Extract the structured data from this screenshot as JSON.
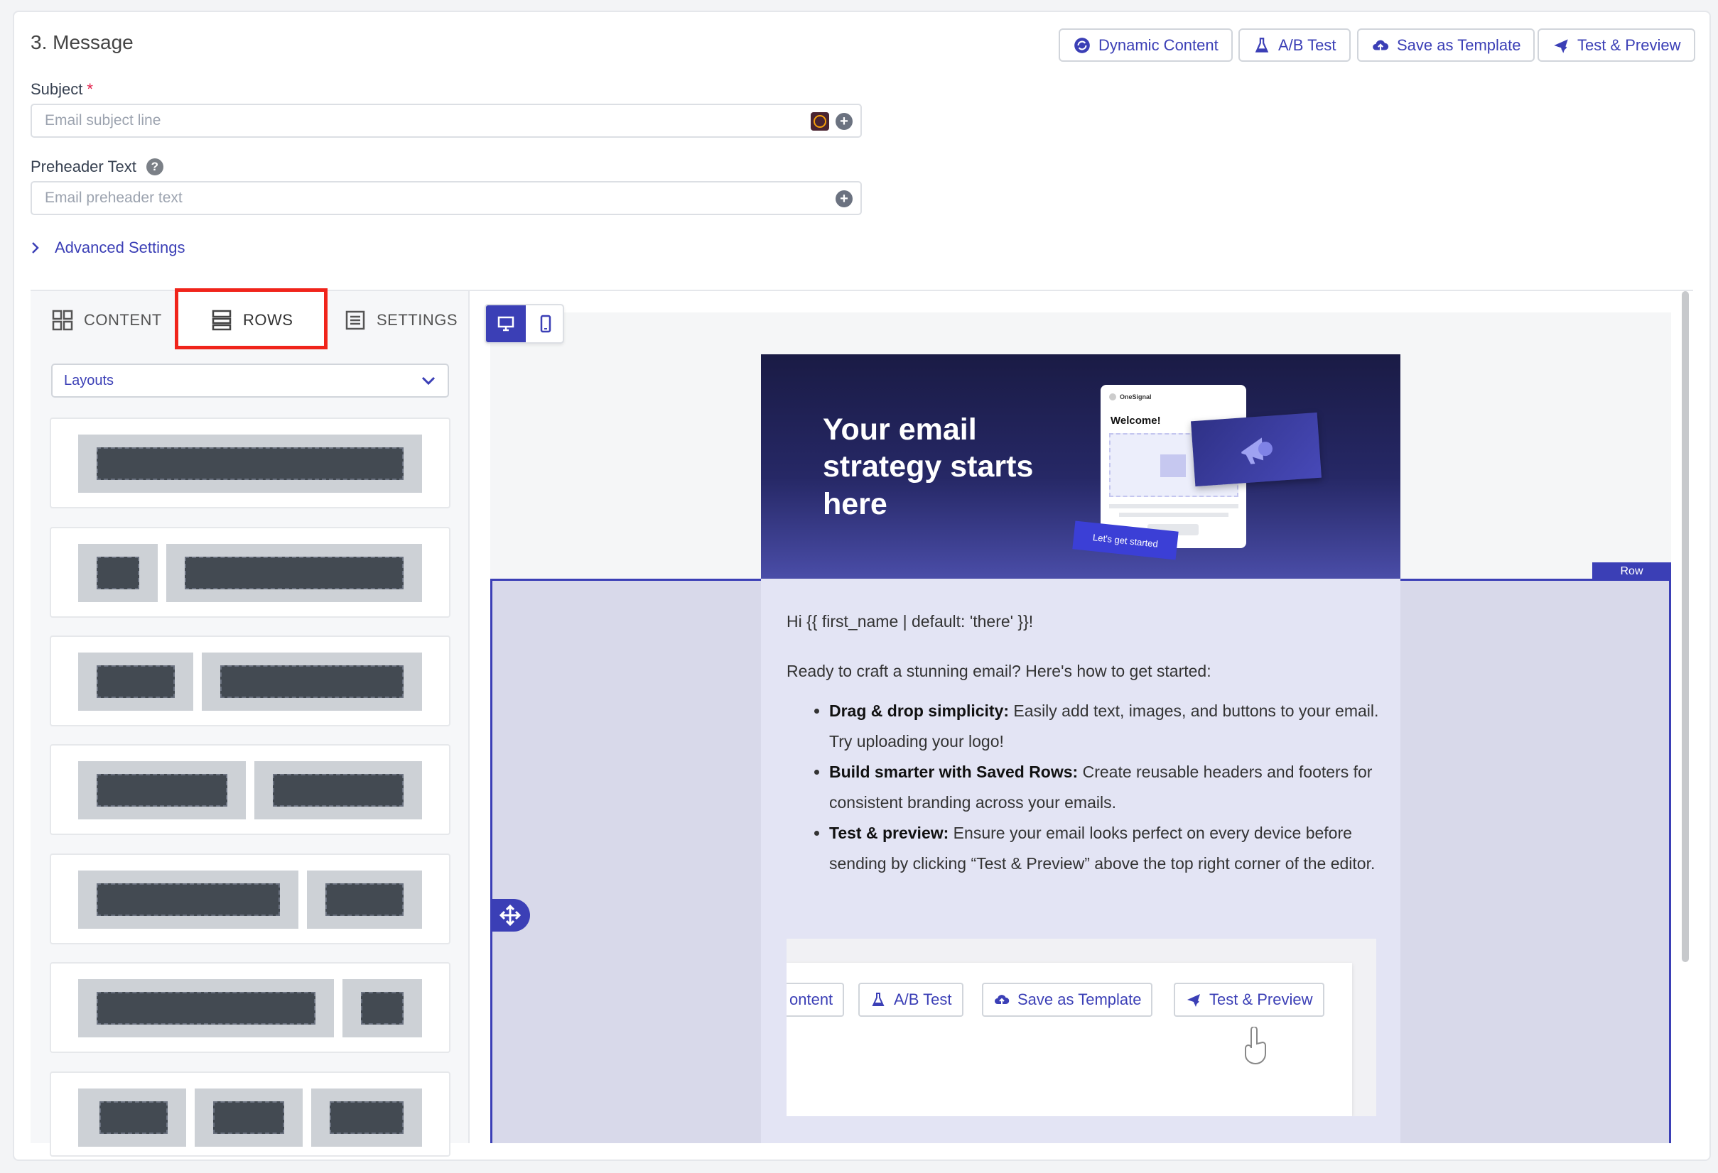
{
  "section": {
    "title": "3. Message"
  },
  "toolbar": {
    "dynamic_content": "Dynamic Content",
    "ab_test": "A/B Test",
    "save_template": "Save as Template",
    "test_preview": "Test & Preview"
  },
  "subject": {
    "label": "Subject",
    "required_mark": "*",
    "placeholder": "Email subject line"
  },
  "preheader": {
    "label": "Preheader Text",
    "placeholder": "Email preheader text"
  },
  "advanced": {
    "label": "Advanced Settings"
  },
  "tabs": {
    "content": "CONTENT",
    "rows": "ROWS",
    "settings": "SETTINGS"
  },
  "layouts_select": {
    "value": "Layouts"
  },
  "email": {
    "hero_title": "Your email strategy starts here",
    "mock_brand": "OneSignal",
    "mock_welcome": "Welcome!",
    "mock_cta": "Let's get started",
    "row_badge": "Row",
    "greeting": "Hi {{ first_name | default: 'there' }}!",
    "intro": "Ready to craft a stunning email? Here's how to get started:",
    "bullets": [
      {
        "bold": "Drag & drop simplicity:",
        "text": " Easily add text, images, and buttons to your email. Try uploading your logo!"
      },
      {
        "bold": "Build smarter with Saved Rows:",
        "text": " Create reusable headers and footers for consistent branding across your emails."
      },
      {
        "bold": "Test & preview:",
        "text": " Ensure your email looks perfect on every device before sending by clicking “Test & Preview” above the top right corner of the editor."
      }
    ],
    "inner_buttons": {
      "content": "ontent",
      "ab": "A/B Test",
      "save": "Save as Template",
      "test": "Test & Preview"
    }
  },
  "colors": {
    "accent": "#3b3fb6",
    "highlight": "#f0241b"
  }
}
